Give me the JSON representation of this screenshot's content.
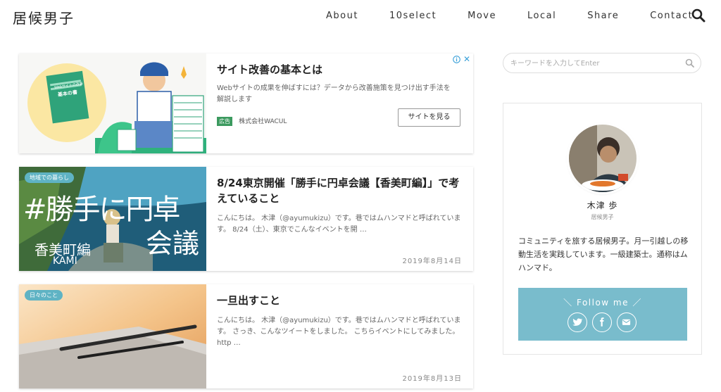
{
  "header": {
    "site_title": "居候男子",
    "nav": [
      "About",
      "10select",
      "Move",
      "Local",
      "Share",
      "Contact"
    ]
  },
  "ad": {
    "title": "サイト改善の基本とは",
    "description": "Webサイトの成果を伸ばすには？データから改善施策を見つけ出す手法を解説します",
    "label": "広告",
    "sponsor": "株式会社WACUL",
    "button": "サイトを見る",
    "book_text_1": "Webサイトの改善",
    "book_text_2": "基本の書"
  },
  "posts": [
    {
      "category": "地域での暮らし",
      "title": "8/24東京開催「勝手に円卓会議【香美町編】」で考えていること",
      "excerpt": "こんにちは。 木津（@ayumukizu）です。巷ではムハンマドと呼ばれています。 8/24（土）、東京でこんなイベントを開 …",
      "date": "2019年8月14日",
      "thumb_text_1": "#勝手に円卓",
      "thumb_text_2": "会議",
      "thumb_text_3": "香美町編",
      "thumb_text_4": "KAMI"
    },
    {
      "category": "日々のこと",
      "title": "一旦出すこと",
      "excerpt": "こんにちは。 木津（@ayumukizu）です。巷ではムハンマドと呼ばれています。 さっき、こんなツイートをしました。 こちらイベントにしてみました。 http …",
      "date": "2019年8月13日"
    }
  ],
  "sidebar": {
    "search_placeholder": "キーワードを入力してEnter",
    "profile": {
      "name": "木津 歩",
      "subtitle": "居候男子",
      "bio": "コミュニティを旅する居候男子。月一引越しの移動生活を実践しています。一級建築士。通称はムハンマド。",
      "follow_title": "＼ Follow me ／"
    }
  },
  "colors": {
    "accent": "#79bccc",
    "badge": "#5fb3c4",
    "ad_label": "#3c9a5f"
  }
}
